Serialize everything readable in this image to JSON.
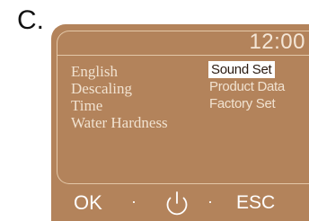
{
  "figure_label": "C.",
  "display": {
    "time": "12:00",
    "menu_left": [
      "English",
      "Descaling",
      "Time",
      "Water Hardness"
    ],
    "menu_right": [
      "Sound Set",
      "Product Data",
      "Factory Set"
    ],
    "selected_item": "Sound Set"
  },
  "soft_keys": {
    "ok_label": "OK",
    "separator": "·",
    "power_icon": "power-icon",
    "esc_label": "ESC"
  },
  "colors": {
    "device_body": "#b3835b",
    "screen_border": "#e3c7a8",
    "text": "#f1e2d0",
    "selection_bg": "#ffffff"
  }
}
